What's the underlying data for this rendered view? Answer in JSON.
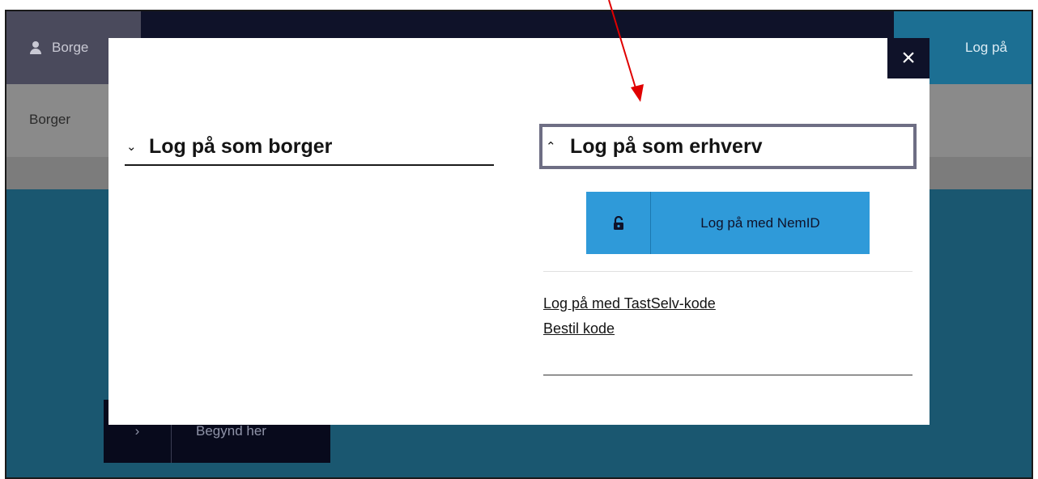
{
  "background": {
    "tab_borger": "Borge",
    "top_login": "Log på",
    "breadcrumb": "Borger",
    "cta": "Begynd her"
  },
  "modal": {
    "close_icon": "×",
    "citizen_section": {
      "chevron": "⌄",
      "title": "Log på som borger"
    },
    "business_section": {
      "chevron": "⌃",
      "title": "Log på som erhverv"
    },
    "nemid_button": {
      "icon": "lock-icon",
      "label": "Log på med NemID"
    },
    "links": {
      "tastselv": "Log på med TastSelv-kode",
      "order_code": "Bestil kode"
    }
  },
  "colors": {
    "nemid_blue": "#2f9ad9",
    "navy": "#0f1229",
    "annotation_red": "#e00000"
  }
}
